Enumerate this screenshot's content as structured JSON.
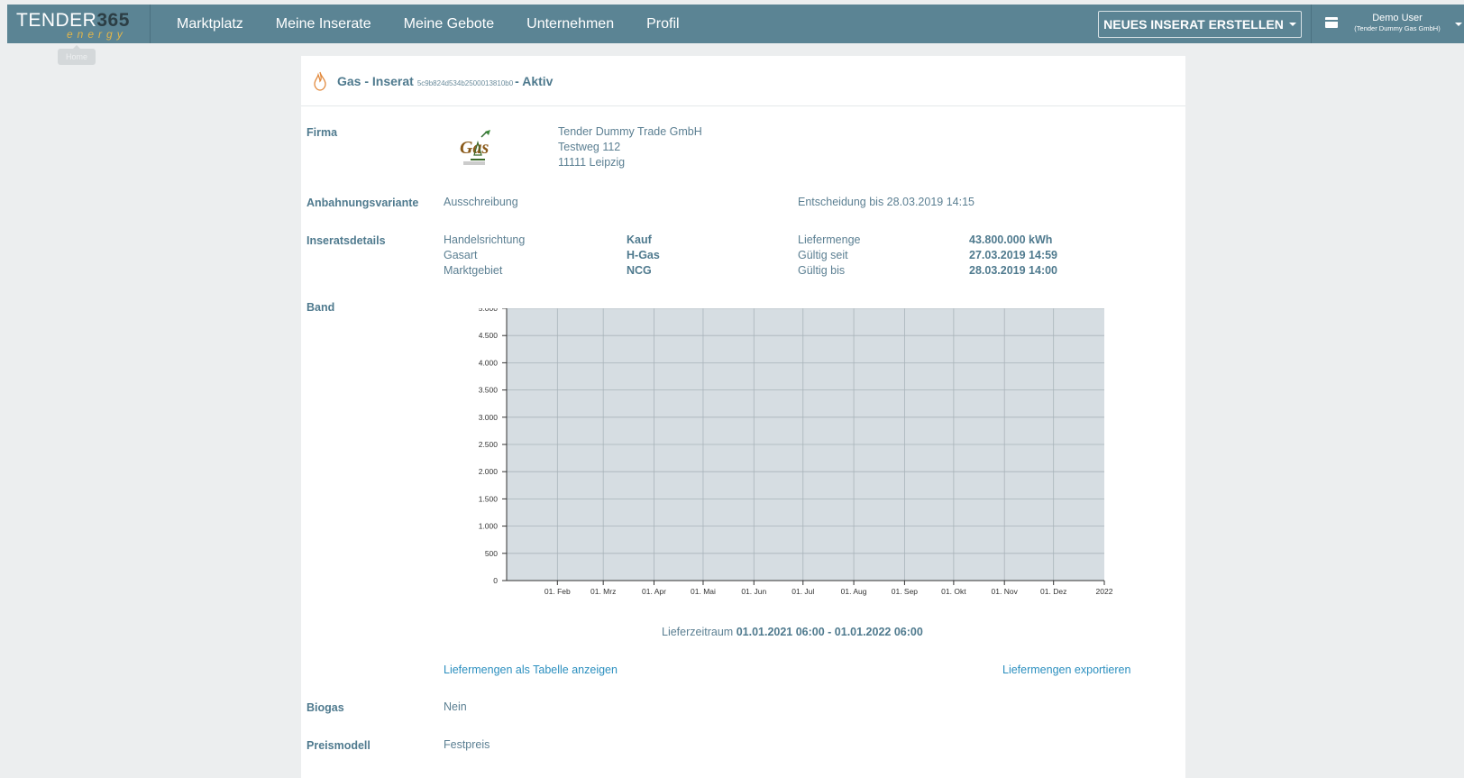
{
  "nav": {
    "brand_text": "TENDER",
    "brand_num": "365",
    "brand_sub": "energy",
    "items": [
      "Marktplatz",
      "Meine Inserate",
      "Meine Gebote",
      "Unternehmen",
      "Profil"
    ],
    "create_button": "NEUES INSERAT ERSTELLEN",
    "user_name": "Demo User",
    "user_company": "(Tender Dummy Gas GmbH)",
    "tooltip": "Home"
  },
  "header": {
    "title": "Gas - Inserat",
    "id": "5c9b824d534b2500013810b0",
    "status": "- Aktiv"
  },
  "firma": {
    "label": "Firma",
    "name": "Tender Dummy Trade GmbH",
    "street": "Testweg 112",
    "city": "11111 Leipzig"
  },
  "anbahnung": {
    "label": "Anbahnungsvariante",
    "value": "Ausschreibung",
    "decision": "Entscheidung bis 28.03.2019 14:15"
  },
  "details": {
    "label": "Inseratsdetails",
    "left": [
      {
        "k": "Handelsrichtung",
        "v": "Kauf"
      },
      {
        "k": "Gasart",
        "v": "H-Gas"
      },
      {
        "k": "Marktgebiet",
        "v": "NCG"
      }
    ],
    "right": [
      {
        "k": "Liefermenge",
        "v": "43.800.000 kWh"
      },
      {
        "k": "Gültig seit",
        "v": "27.03.2019 14:59"
      },
      {
        "k": "Gültig bis",
        "v": "28.03.2019 14:00"
      }
    ]
  },
  "band": {
    "label": "Band"
  },
  "chart_data": {
    "type": "area",
    "title": "",
    "xlabel": "",
    "ylabel": "",
    "ylim": [
      0,
      5000
    ],
    "yticks": [
      "0",
      "500",
      "1.000",
      "1.500",
      "2.000",
      "2.500",
      "3.000",
      "3.500",
      "4.000",
      "4.500",
      "5.000"
    ],
    "xticks": [
      "01. Feb",
      "01. Mrz",
      "01. Apr",
      "01. Mai",
      "01. Jun",
      "01. Jul",
      "01. Aug",
      "01. Sep",
      "01. Okt",
      "01. Nov",
      "01. Dez",
      "2022"
    ],
    "grid": true,
    "fill_color": "#d6dde2",
    "series": [
      {
        "x": [
          "2021-01-01",
          "2022-01-01"
        ],
        "values": [
          5000,
          5000
        ]
      }
    ]
  },
  "lieferzeitraum": {
    "prefix": "Lieferzeitraum",
    "range": "01.01.2021 06:00 - 01.01.2022 06:00"
  },
  "links": {
    "table": "Liefermengen als Tabelle anzeigen",
    "export": "Liefermengen exportieren"
  },
  "biogas": {
    "label": "Biogas",
    "value": "Nein"
  },
  "preismodell": {
    "label": "Preismodell",
    "value": "Festpreis"
  }
}
